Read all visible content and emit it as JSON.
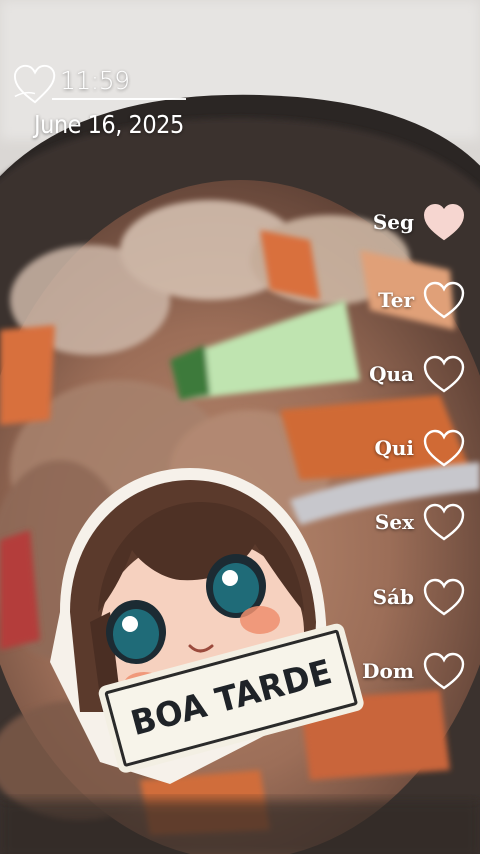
{
  "clock": {
    "time": "11:59",
    "date": "June 16, 2025",
    "icon": "heart-outline-icon"
  },
  "weekdays": [
    {
      "label": "Seg",
      "icon": "heart-filled-icon",
      "filled": true
    },
    {
      "label": "Ter",
      "icon": "heart-outline-icon",
      "filled": false
    },
    {
      "label": "Qua",
      "icon": "heart-outline-icon",
      "filled": false
    },
    {
      "label": "Qui",
      "icon": "heart-outline-icon",
      "filled": false
    },
    {
      "label": "Sex",
      "icon": "heart-outline-icon",
      "filled": false
    },
    {
      "label": "Sáb",
      "icon": "heart-outline-icon",
      "filled": false
    },
    {
      "label": "Dom",
      "icon": "heart-outline-icon",
      "filled": false
    }
  ],
  "sticker": {
    "banner_text": "BOA TARDE"
  },
  "colors": {
    "heart_fill": "#f6d6d0",
    "text": "#ffffff",
    "banner_text": "#1f2328"
  }
}
